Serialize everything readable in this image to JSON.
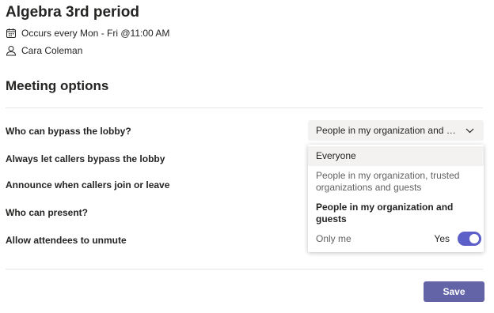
{
  "meeting": {
    "title": "Algebra 3rd period",
    "schedule": "Occurs every Mon - Fri @11:00 AM",
    "organizer": "Cara Coleman"
  },
  "section_title": "Meeting options",
  "options": {
    "bypass_lobby": "Who can bypass the lobby?",
    "callers_bypass": "Always let callers bypass the lobby",
    "announce_callers": "Announce when callers join or leave",
    "who_can_present": "Who can present?",
    "allow_unmute": "Allow attendees to unmute"
  },
  "dropdown": {
    "selected": "People in my organization and guests",
    "items": [
      "Everyone",
      "People in my organization, trusted organizations and guests",
      "People in my organization and guests",
      "Only me"
    ]
  },
  "unmute_toggle": {
    "label": "Yes",
    "on": true
  },
  "save_label": "Save",
  "colors": {
    "accent": "#6264a7",
    "toggle": "#5b5fc7"
  }
}
